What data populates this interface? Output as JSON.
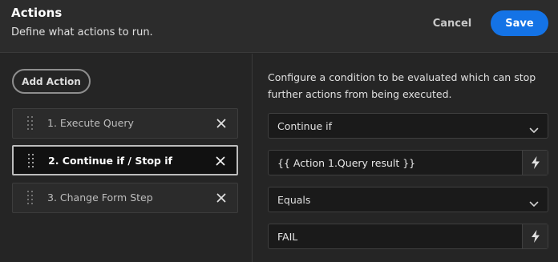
{
  "header": {
    "title": "Actions",
    "subtitle": "Define what actions to run.",
    "cancel_label": "Cancel",
    "save_label": "Save"
  },
  "left_panel": {
    "add_action_label": "Add Action",
    "actions": [
      {
        "label": "1. Execute Query",
        "selected": false
      },
      {
        "label": "2. Continue if / Stop if",
        "selected": true
      },
      {
        "label": "3. Change Form Step",
        "selected": false
      }
    ]
  },
  "right_panel": {
    "description": "Configure a condition to be evaluated which can stop further actions from being executed.",
    "condition_type": "Continue if",
    "value_left": "{{ Action 1.Query result }}",
    "operator": "Equals",
    "value_right": "FAIL"
  },
  "icons": {
    "remove": "close-icon",
    "drag": "drag-handle-icon",
    "dropdown": "chevron-down-icon",
    "binding": "lightning-bolt-icon"
  },
  "colors": {
    "accent": "#1473e6",
    "background": "#252525",
    "header": "#2c2c2c"
  }
}
